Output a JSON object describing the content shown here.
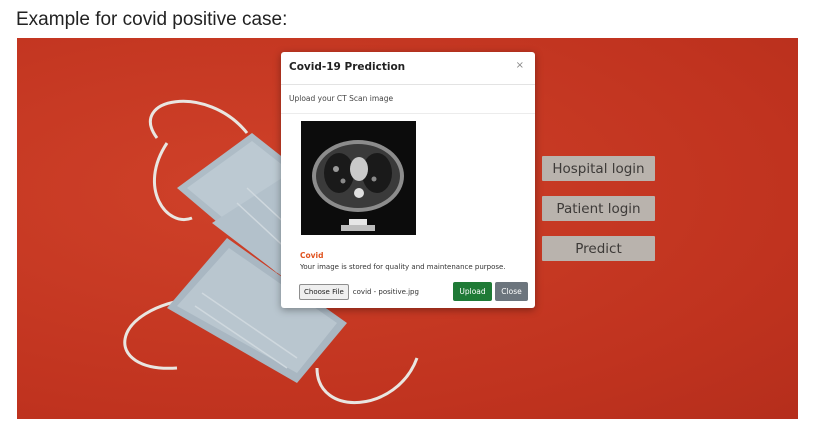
{
  "caption": "Example for covid positive case:",
  "modal": {
    "title": "Covid-19 Prediction",
    "close_symbol": "×",
    "subtitle": "Upload your CT Scan image",
    "result_label": "Covid",
    "result_message": "Your image is stored for quality and maintenance purpose.",
    "choose_file_label": "Choose File",
    "file_name": "covid - positive.jpg",
    "upload_label": "Upload",
    "close_label": "Close"
  },
  "side_buttons": {
    "hospital_login": "Hospital login",
    "patient_login": "Patient login",
    "predict": "Predict"
  },
  "colors": {
    "background": "#c93a24",
    "side_button": "#b9b3ad",
    "upload_button": "#1f7a36",
    "close_button": "#6c757d",
    "result_label": "#e0531f"
  },
  "images": {
    "background": "surgical-mask-photo",
    "scan": "ct-scan-image"
  }
}
